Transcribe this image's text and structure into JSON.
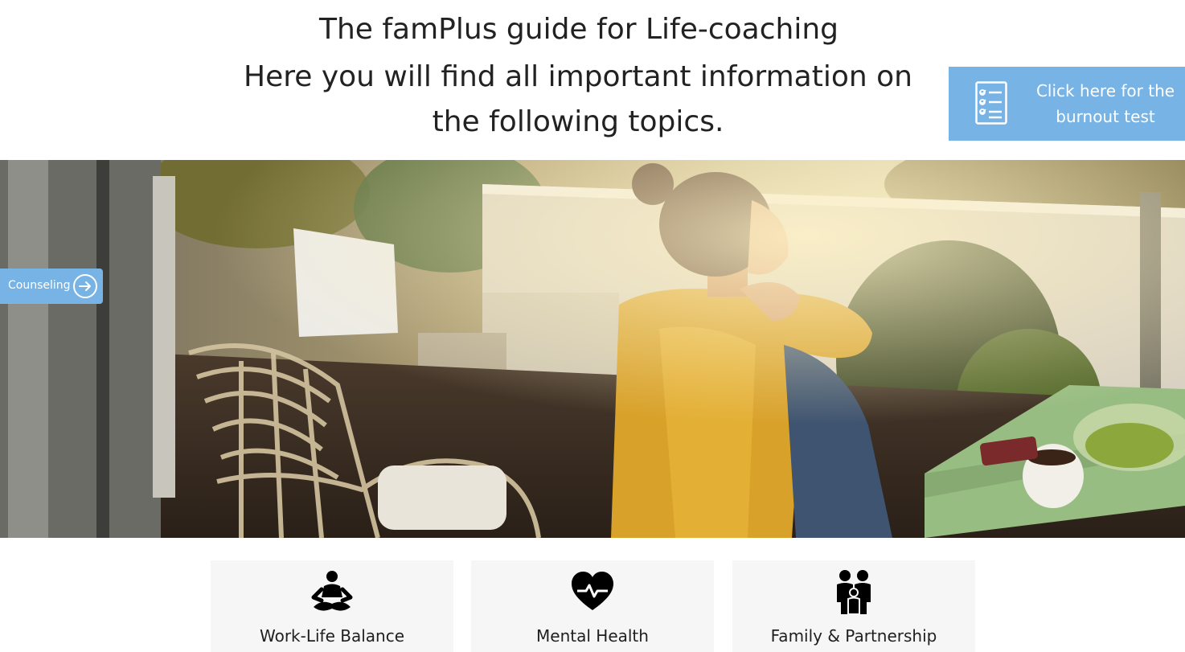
{
  "heading": {
    "title": "The famPlus guide for Life-coaching",
    "subtitle": "Here you will find all important information on the following topics."
  },
  "burnout_cta": {
    "label": "Click here for the burnout test",
    "icon": "checklist-document-icon",
    "color": "#77b3e4"
  },
  "side_tab": {
    "label": "Counseling",
    "icon": "arrow-right-circle-icon",
    "color": "#77b3e4"
  },
  "topics": [
    {
      "label": "Work-Life Balance",
      "icon": "meditation-person-icon"
    },
    {
      "label": "Mental Health",
      "icon": "heart-pulse-icon"
    },
    {
      "label": "Family & Partnership",
      "icon": "family-icon"
    }
  ],
  "colors": {
    "accent": "#77b3e4",
    "card_background": "#f6f6f6"
  }
}
